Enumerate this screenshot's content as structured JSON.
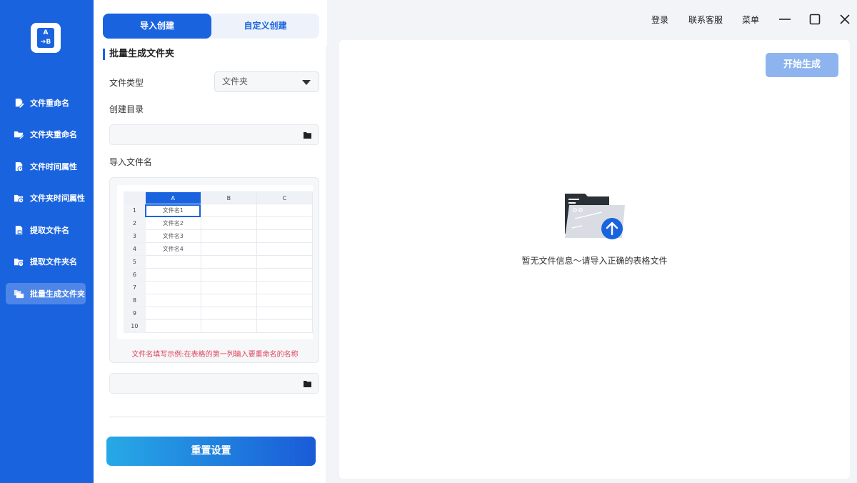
{
  "sidebar": {
    "items": [
      {
        "label": "文件重命名"
      },
      {
        "label": "文件夹重命名"
      },
      {
        "label": "文件时间属性"
      },
      {
        "label": "文件夹时间属性"
      },
      {
        "label": "提取文件名"
      },
      {
        "label": "提取文件夹名"
      },
      {
        "label": "批量生成文件夹",
        "active": true
      }
    ]
  },
  "tabs": {
    "import": "导入创建",
    "custom": "自定义创建"
  },
  "form": {
    "section_title": "批量生成文件夹",
    "file_type_label": "文件类型",
    "file_type_value": "文件夹",
    "dir_label": "创建目录",
    "dir_value": "",
    "import_label": "导入文件名",
    "import_value": "",
    "hint": "文件名填写示例:在表格的第一列输入要重命名的名称",
    "reset_label": "重置设置"
  },
  "sheet": {
    "columns": [
      "A",
      "B",
      "C"
    ],
    "rows": [
      "1",
      "2",
      "3",
      "4",
      "5",
      "6",
      "7",
      "8",
      "9",
      "10"
    ],
    "values": [
      "文件名1",
      "文件名2",
      "文件名3",
      "文件名4"
    ]
  },
  "topbar": {
    "login": "登录",
    "support": "联系客服",
    "menu": "菜单"
  },
  "main": {
    "start_label": "开始生成",
    "empty_text": "暂无文件信息～请导入正确的表格文件"
  },
  "colors": {
    "primary": "#1a63df",
    "sidebar_active": "#4e86e8",
    "start_disabled": "#8db4ee",
    "hint": "#e0445a"
  }
}
